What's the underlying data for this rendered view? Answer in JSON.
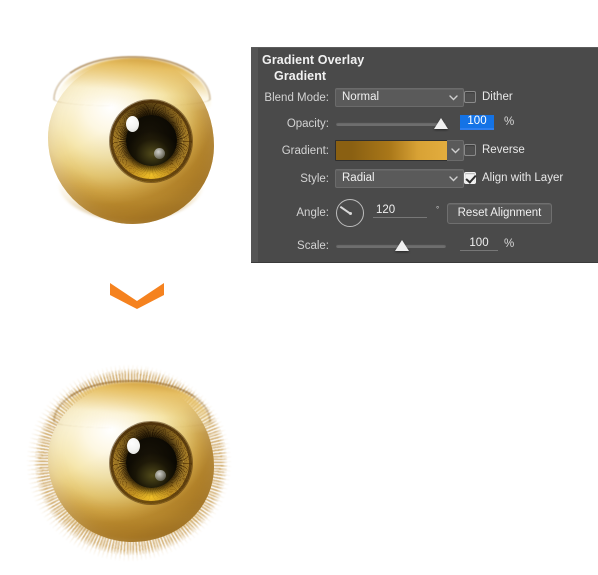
{
  "panel": {
    "title": "Gradient Overlay",
    "subtitle": "Gradient",
    "blend_mode": {
      "label": "Blend Mode:",
      "value": "Normal"
    },
    "dither": {
      "label": "Dither",
      "checked": false
    },
    "opacity": {
      "label": "Opacity:",
      "value": "100",
      "unit": "%",
      "slider_percent": 100,
      "selected": true
    },
    "gradient": {
      "label": "Gradient:",
      "color_left": "#8a6012",
      "color_right": "#e3ad3e"
    },
    "reverse": {
      "label": "Reverse",
      "checked": false
    },
    "style": {
      "label": "Style:",
      "value": "Radial"
    },
    "align_with_layer": {
      "label": "Align with Layer",
      "checked": true
    },
    "angle": {
      "label": "Angle:",
      "value": "120",
      "unit": "°"
    },
    "reset_alignment": {
      "label": "Reset Alignment"
    },
    "scale": {
      "label": "Scale:",
      "value": "100",
      "unit": "%",
      "slider_percent": 45
    },
    "background_color": "#4a4a4a"
  },
  "illustrations": {
    "top_eye": {
      "name": "golden eyeball without fur"
    },
    "arrow": {
      "name": "down chevron",
      "color": "#f5821f"
    },
    "bottom_eye": {
      "name": "golden eyeball with fur fringe"
    }
  }
}
